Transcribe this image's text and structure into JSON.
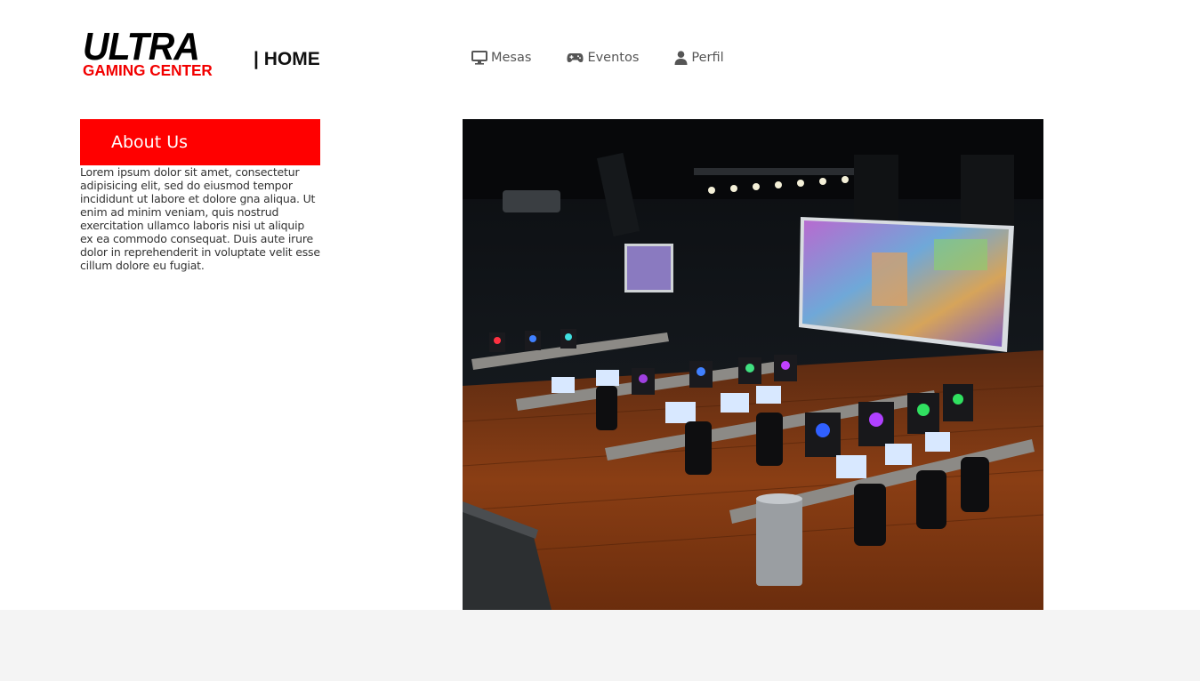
{
  "header": {
    "logo": {
      "line1": "ULTRA",
      "line2": "GAMING CENTER"
    },
    "page_title": "| HOME"
  },
  "nav": {
    "items": [
      {
        "label": "Mesas",
        "icon": "monitor-icon"
      },
      {
        "label": "Eventos",
        "icon": "gamepad-icon"
      },
      {
        "label": "Perfil",
        "icon": "user-icon"
      }
    ]
  },
  "about": {
    "title": "About Us",
    "text": "Lorem ipsum dolor sit amet, consectetur adipisicing elit, sed do eiusmod tempor incididunt ut labore et dolore gna aliqua. Ut enim ad minim veniam, quis nostrud exercitation ullamco laboris nisi ut aliquip ex ea commodo consequat. Duis aute irure dolor in reprehenderit in voluptate velit esse cillum dolore eu fugiat."
  },
  "colors": {
    "accent": "#ff0000",
    "footer_band": "#f4f4f4",
    "nav_text": "#555555"
  }
}
